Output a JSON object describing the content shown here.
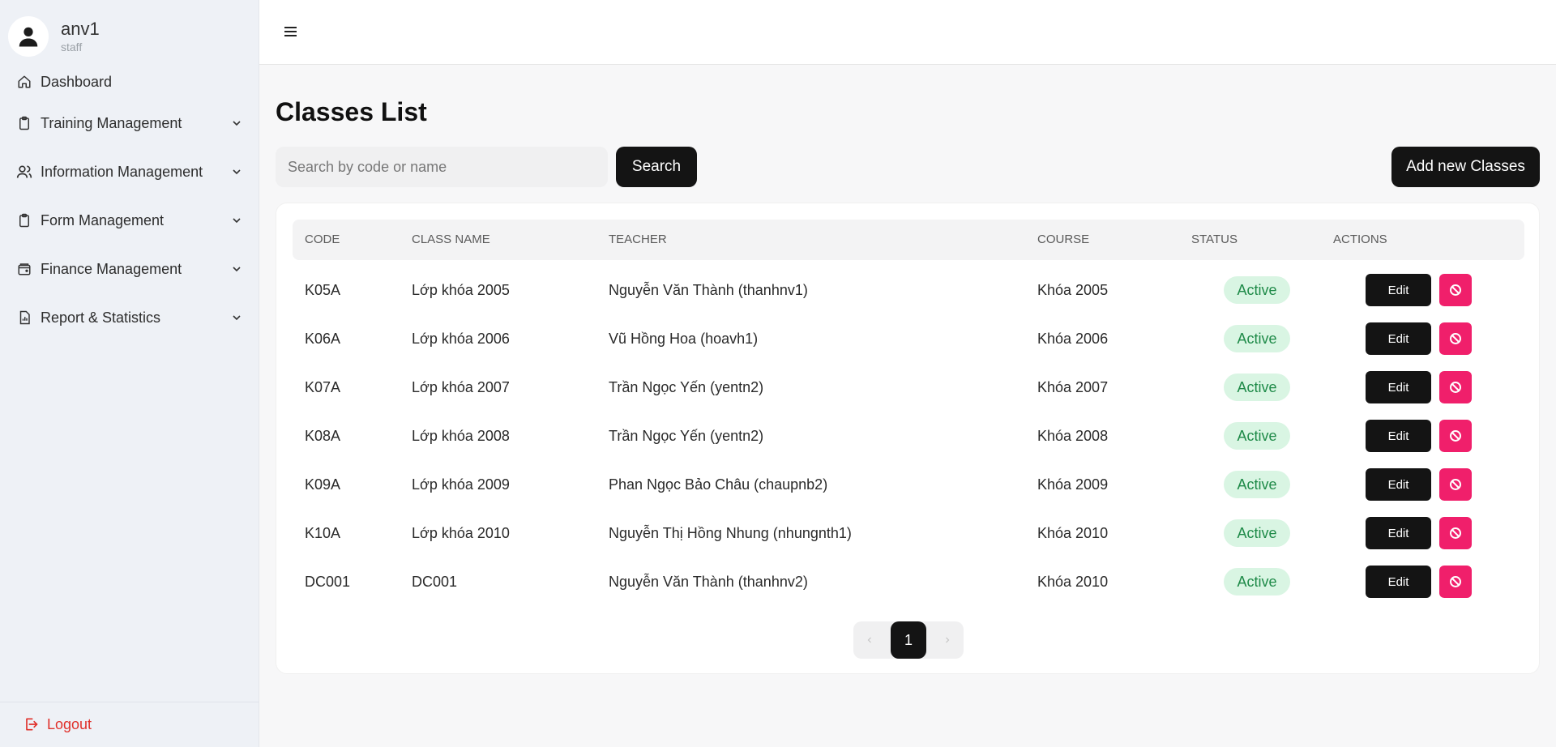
{
  "user": {
    "name": "anv1",
    "role": "staff"
  },
  "sidebar": {
    "items": [
      {
        "label": "Dashboard",
        "icon": "home-icon"
      },
      {
        "label": "Training Management",
        "icon": "clipboard-icon"
      },
      {
        "label": "Information Management",
        "icon": "users-icon"
      },
      {
        "label": "Form Management",
        "icon": "clipboard-icon"
      },
      {
        "label": "Finance Management",
        "icon": "wallet-icon"
      },
      {
        "label": "Report & Statistics",
        "icon": "report-icon"
      }
    ],
    "logout": "Logout"
  },
  "page": {
    "title": "Classes List",
    "search_placeholder": "Search by code or name",
    "search_button": "Search",
    "add_button": "Add new Classes"
  },
  "table": {
    "columns": [
      "CODE",
      "CLASS NAME",
      "TEACHER",
      "COURSE",
      "STATUS",
      "ACTIONS"
    ],
    "rows": [
      {
        "code": "K05A",
        "name": "Lớp khóa 2005",
        "teacher": "Nguyễn Văn Thành (thanhnv1)",
        "course": "Khóa 2005",
        "status": "Active",
        "edit": "Edit"
      },
      {
        "code": "K06A",
        "name": "Lớp khóa 2006",
        "teacher": "Vũ Hồng Hoa (hoavh1)",
        "course": "Khóa 2006",
        "status": "Active",
        "edit": "Edit"
      },
      {
        "code": "K07A",
        "name": "Lớp khóa 2007",
        "teacher": "Trần Ngọc Yến (yentn2)",
        "course": "Khóa 2007",
        "status": "Active",
        "edit": "Edit"
      },
      {
        "code": "K08A",
        "name": "Lớp khóa 2008",
        "teacher": "Trần Ngọc Yến (yentn2)",
        "course": "Khóa 2008",
        "status": "Active",
        "edit": "Edit"
      },
      {
        "code": "K09A",
        "name": "Lớp khóa 2009",
        "teacher": "Phan Ngọc Bảo Châu (chaupnb2)",
        "course": "Khóa 2009",
        "status": "Active",
        "edit": "Edit"
      },
      {
        "code": "K10A",
        "name": "Lớp khóa 2010",
        "teacher": "Nguyễn Thị Hồng Nhung (nhungnth1)",
        "course": "Khóa 2010",
        "status": "Active",
        "edit": "Edit"
      },
      {
        "code": "DC001",
        "name": "DC001",
        "teacher": "Nguyễn Văn Thành (thanhnv2)",
        "course": "Khóa 2010",
        "status": "Active",
        "edit": "Edit"
      }
    ]
  },
  "pagination": {
    "current": "1",
    "prev_icon": "chevron-left-icon",
    "next_icon": "chevron-right-icon"
  },
  "colors": {
    "accent_dark": "#141414",
    "status_active_bg": "#d9f5e3",
    "status_active_text": "#1e8a48",
    "danger": "#f01f6b",
    "logout": "#e0312b"
  }
}
